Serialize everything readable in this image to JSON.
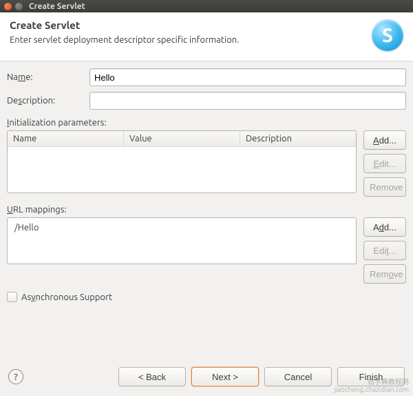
{
  "titlebar": {
    "title": "Create Servlet"
  },
  "header": {
    "title": "Create Servlet",
    "subtitle": "Enter servlet deployment descriptor specific information.",
    "icon_letter": "S"
  },
  "form": {
    "name_label_pre": "Na",
    "name_label_u": "m",
    "name_label_post": "e:",
    "name_value": "Hello",
    "desc_label_pre": "De",
    "desc_label_u": "s",
    "desc_label_post": "cription:",
    "desc_value": ""
  },
  "init_params": {
    "label_pre": "",
    "label_u": "I",
    "label_post": "nitialization parameters:",
    "columns": {
      "name": "Name",
      "value": "Value",
      "description": "Description"
    },
    "rows": []
  },
  "init_buttons": {
    "add_pre": "",
    "add_u": "A",
    "add_post": "dd...",
    "edit_pre": "",
    "edit_u": "E",
    "edit_post": "dit...",
    "remove": "Remove"
  },
  "url_map": {
    "label_pre": "",
    "label_u": "U",
    "label_post": "RL mappings:",
    "items": [
      "/Hello"
    ]
  },
  "url_buttons": {
    "add_pre": "A",
    "add_u": "d",
    "add_post": "d...",
    "edit_pre": "Edi",
    "edit_u": "t",
    "edit_post": "...",
    "remove_pre": "Rem",
    "remove_u": "o",
    "remove_post": "ve"
  },
  "async": {
    "label_pre": "As",
    "label_u": "y",
    "label_post": "nchronous Support",
    "checked": false
  },
  "footer": {
    "back": "< Back",
    "next": "Next >",
    "cancel": "Cancel",
    "finish": "Finish"
  },
  "watermark": {
    "line1": "指字典教程网",
    "line2": "jiaocheng.chazidian.com"
  }
}
